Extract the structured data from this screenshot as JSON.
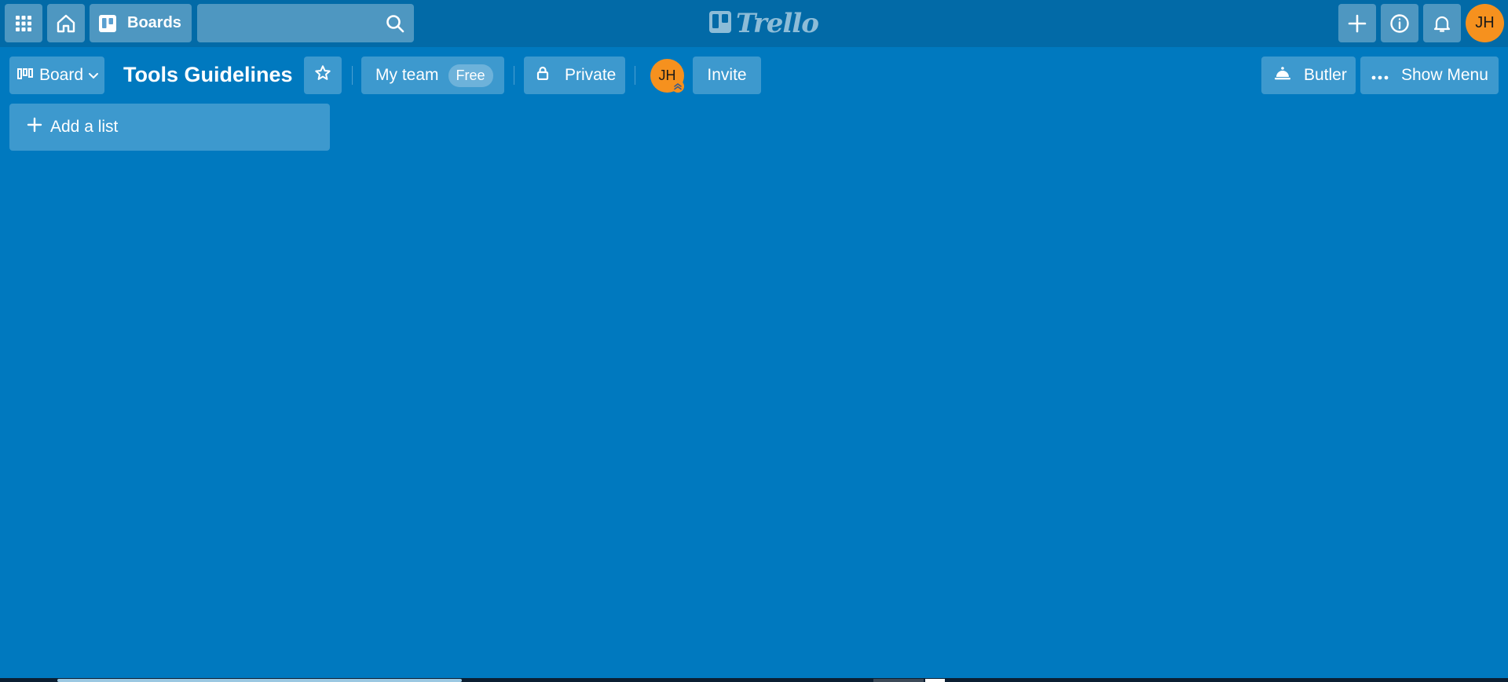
{
  "header": {
    "boards_label": "Boards",
    "search": {
      "value": "",
      "placeholder": ""
    },
    "logo_text": "Trello",
    "user_initials": "JH"
  },
  "board": {
    "view_label": "Board",
    "title": "Tools Guidelines",
    "team_name": "My team",
    "team_plan": "Free",
    "privacy_label": "Private",
    "member_initials": "JH",
    "invite_label": "Invite",
    "butler_label": "Butler",
    "menu_label": "Show Menu"
  },
  "lists": {
    "add_list_label": "Add a list"
  },
  "colors": {
    "board_background": "#0079bf",
    "header_background": "#026aa7",
    "avatar": "#f6911e"
  },
  "icons": [
    "apps-grid-icon",
    "home-icon",
    "boards-icon",
    "search-icon",
    "trello-logo-icon",
    "plus-icon",
    "info-icon",
    "bell-icon",
    "board-view-icon",
    "chevron-down-icon",
    "star-icon",
    "lock-icon",
    "butler-bell-icon",
    "ellipsis-icon"
  ]
}
